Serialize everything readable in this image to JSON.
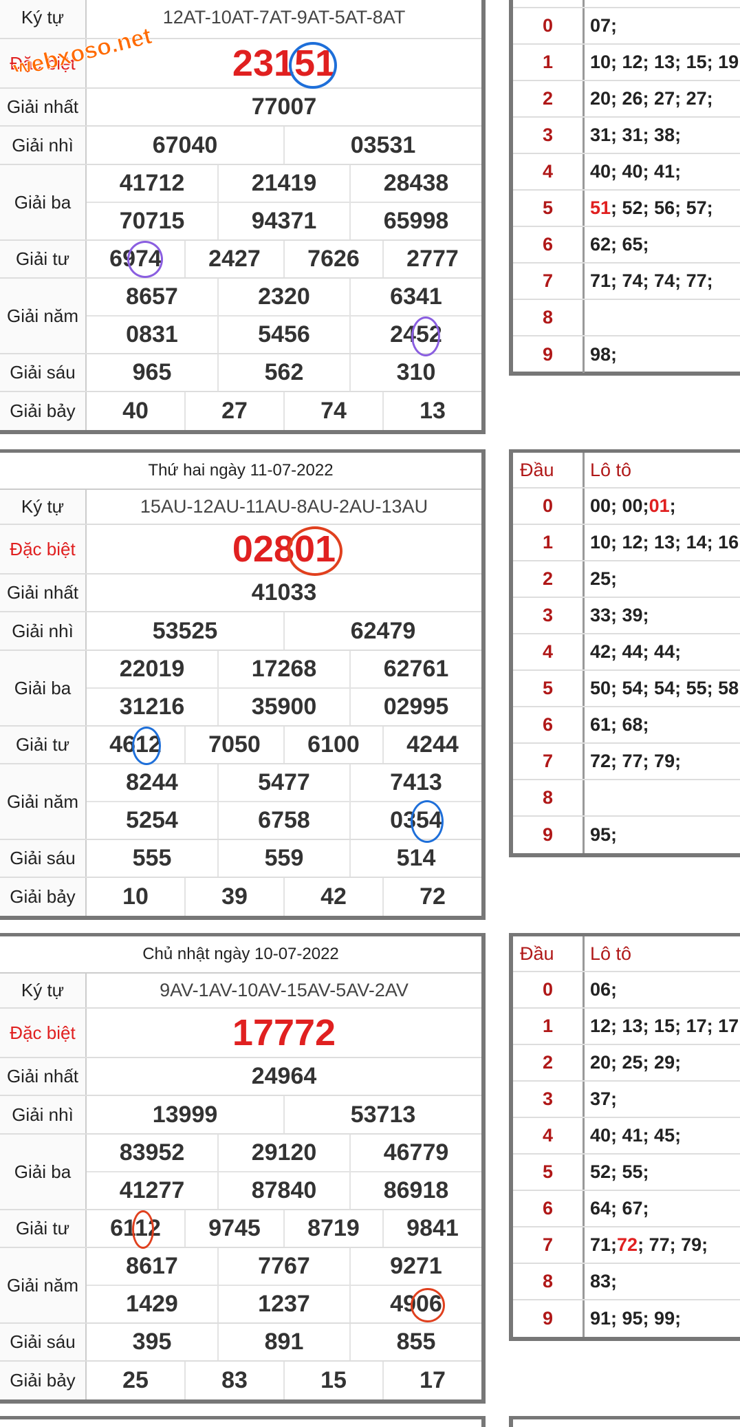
{
  "watermark": "webxoso.net",
  "labels": {
    "kytu": "Ký tự",
    "db": "Đặc biệt",
    "g1": "Giải nhất",
    "g2": "Giải nhì",
    "g3": "Giải ba",
    "g4": "Giải tư",
    "g5": "Giải năm",
    "g6": "Giải sáu",
    "g7": "Giải bảy",
    "dau": "Đầu",
    "loto": "Lô tô"
  },
  "colors": {
    "accent_red": "#e02020",
    "circle_blue": "#1e6fd9",
    "circle_purple": "#8a5ee0",
    "circle_red": "#e0401e"
  },
  "results": [
    {
      "date": "",
      "kytu": "12AT-10AT-7AT-9AT-5AT-8AT",
      "db": "23151",
      "g1": "77007",
      "g2": [
        "67040",
        "03531"
      ],
      "g3": [
        "41712",
        "21419",
        "28438",
        "70715",
        "94371",
        "65998"
      ],
      "g4": [
        "6974",
        "2427",
        "7626",
        "2777"
      ],
      "g5": [
        "8657",
        "2320",
        "6341",
        "0831",
        "5456",
        "2452"
      ],
      "g6": [
        "965",
        "562",
        "310"
      ],
      "g7": [
        "40",
        "27",
        "74",
        "13"
      ],
      "loto": [
        {
          "dau": "0",
          "nums": "07;"
        },
        {
          "dau": "1",
          "nums": "10; 12; 13; 15; 19"
        },
        {
          "dau": "2",
          "nums": "20; 26; 27; 27;"
        },
        {
          "dau": "3",
          "nums": "31; 31; 38;"
        },
        {
          "dau": "4",
          "nums": "40; 40; 41;"
        },
        {
          "dau": "5",
          "hl": "51",
          "nums": "; 52; 56; 57;"
        },
        {
          "dau": "6",
          "nums": "62; 65;"
        },
        {
          "dau": "7",
          "nums": "71; 74; 74; 77;"
        },
        {
          "dau": "8",
          "nums": ""
        },
        {
          "dau": "9",
          "nums": "98;"
        }
      ]
    },
    {
      "date": "Thứ hai ngày 11-07-2022",
      "kytu": "15AU-12AU-11AU-8AU-2AU-13AU",
      "db": "02801",
      "g1": "41033",
      "g2": [
        "53525",
        "62479"
      ],
      "g3": [
        "22019",
        "17268",
        "62761",
        "31216",
        "35900",
        "02995"
      ],
      "g4": [
        "4612",
        "7050",
        "6100",
        "4244"
      ],
      "g5": [
        "8244",
        "5477",
        "7413",
        "5254",
        "6758",
        "0354"
      ],
      "g6": [
        "555",
        "559",
        "514"
      ],
      "g7": [
        "10",
        "39",
        "42",
        "72"
      ],
      "loto": [
        {
          "dau": "0",
          "nums": "00; 00; ",
          "hl": "01",
          "tail": ";"
        },
        {
          "dau": "1",
          "nums": "10; 12; 13; 14; 16"
        },
        {
          "dau": "2",
          "nums": "25;"
        },
        {
          "dau": "3",
          "nums": "33; 39;"
        },
        {
          "dau": "4",
          "nums": "42; 44; 44;"
        },
        {
          "dau": "5",
          "nums": "50; 54; 54; 55; 58"
        },
        {
          "dau": "6",
          "nums": "61; 68;"
        },
        {
          "dau": "7",
          "nums": "72; 77; 79;"
        },
        {
          "dau": "8",
          "nums": ""
        },
        {
          "dau": "9",
          "nums": "95;"
        }
      ]
    },
    {
      "date": "Chủ nhật ngày 10-07-2022",
      "kytu": "9AV-1AV-10AV-15AV-5AV-2AV",
      "db": "17772",
      "g1": "24964",
      "g2": [
        "13999",
        "53713"
      ],
      "g3": [
        "83952",
        "29120",
        "46779",
        "41277",
        "87840",
        "86918"
      ],
      "g4": [
        "6112",
        "9745",
        "8719",
        "9841"
      ],
      "g5": [
        "8617",
        "7767",
        "9271",
        "1429",
        "1237",
        "4906"
      ],
      "g6": [
        "395",
        "891",
        "855"
      ],
      "g7": [
        "25",
        "83",
        "15",
        "17"
      ],
      "loto": [
        {
          "dau": "0",
          "nums": "06;"
        },
        {
          "dau": "1",
          "nums": "12; 13; 15; 17; 17"
        },
        {
          "dau": "2",
          "nums": "20; 25; 29;"
        },
        {
          "dau": "3",
          "nums": "37;"
        },
        {
          "dau": "4",
          "nums": "40; 41; 45;"
        },
        {
          "dau": "5",
          "nums": "52; 55;"
        },
        {
          "dau": "6",
          "nums": "64; 67;"
        },
        {
          "dau": "7",
          "nums": "71; ",
          "hl": "72",
          "tail": "; 77; 79;"
        },
        {
          "dau": "8",
          "nums": "83;"
        },
        {
          "dau": "9",
          "nums": "91; 95; 99;"
        }
      ]
    }
  ]
}
